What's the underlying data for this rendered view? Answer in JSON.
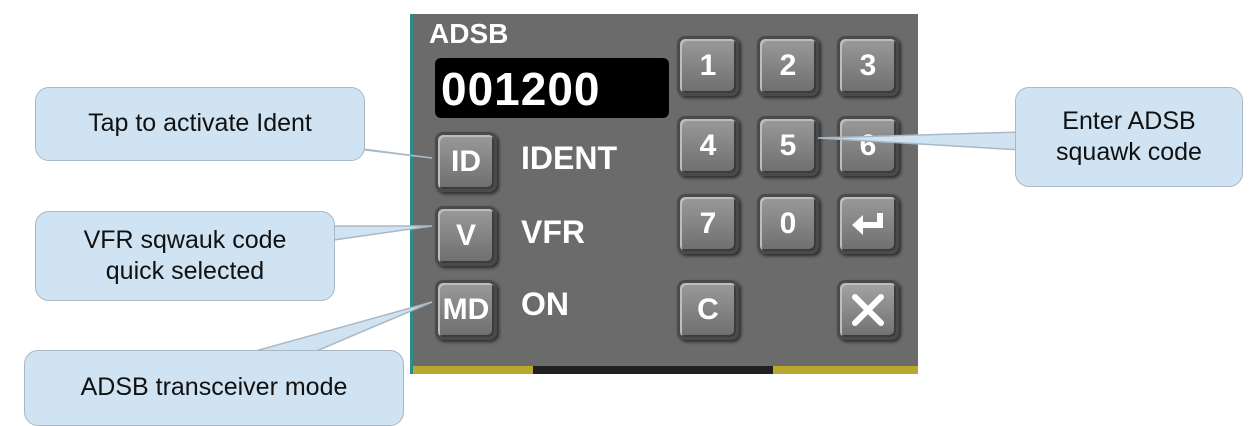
{
  "panel": {
    "title": "ADSB",
    "squawk_code": "001200",
    "ident_button": "ID",
    "ident_label": "IDENT",
    "vfr_button": "V",
    "vfr_label": "VFR",
    "mode_button": "MD",
    "mode_label": "ON",
    "keypad": [
      "1",
      "2",
      "3",
      "4",
      "5",
      "6",
      "7",
      "0"
    ],
    "clear_key": "C",
    "enter_icon": "enter-arrow-icon",
    "close_icon": "close-x-icon"
  },
  "callouts": {
    "ident": "Tap to activate Ident",
    "vfr_line1": "VFR sqwauk code",
    "vfr_line2": "quick selected",
    "mode": "ADSB transceiver mode",
    "squawk_line1": "Enter ADSB",
    "squawk_line2": "squawk code"
  },
  "colors": {
    "panel_bg": "#6b6b6b",
    "callout_bg": "#cfe3f2",
    "display_bg": "#000000",
    "text": "#ffffff"
  }
}
